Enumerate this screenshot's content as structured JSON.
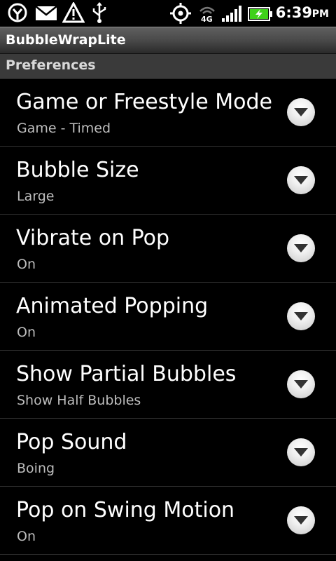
{
  "status_bar": {
    "time": "6:39",
    "ampm": "PM",
    "icons": [
      "htc-peep-icon",
      "mail-icon",
      "warning-icon",
      "usb-icon",
      "gps-icon",
      "4g-icon",
      "signal-icon",
      "battery-charging-icon"
    ],
    "network_label": "4G"
  },
  "app": {
    "title": "BubbleWrapLite"
  },
  "section": {
    "header": "Preferences"
  },
  "preferences": [
    {
      "title": "Game or Freestyle Mode",
      "summary": "Game - Timed"
    },
    {
      "title": "Bubble Size",
      "summary": "Large"
    },
    {
      "title": "Vibrate on Pop",
      "summary": "On"
    },
    {
      "title": "Animated Popping",
      "summary": "On"
    },
    {
      "title": "Show Partial Bubbles",
      "summary": "Show Half Bubbles"
    },
    {
      "title": "Pop Sound",
      "summary": "Boing"
    },
    {
      "title": "Pop on Swing Motion",
      "summary": "On"
    }
  ],
  "colors": {
    "background": "#000000",
    "summary_text": "#bdbdbd",
    "battery_charge": "#3fd11a"
  }
}
